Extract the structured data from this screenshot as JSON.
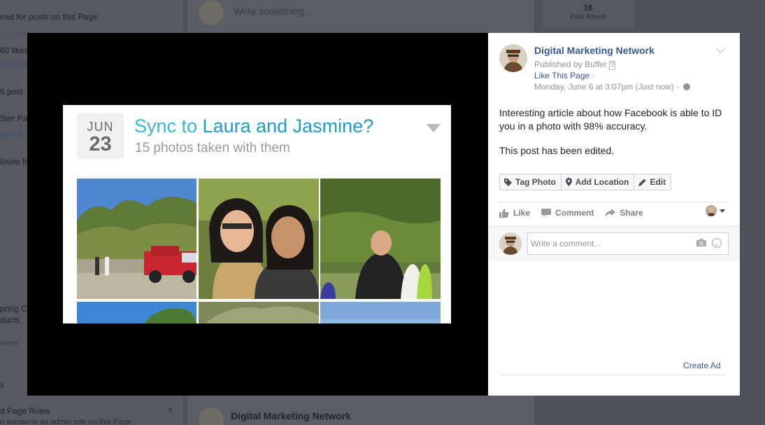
{
  "background_page": {
    "left_column_fragments": [
      "ead for posts on this Page",
      "60 likes",
      "hen Ge",
      "6 post",
      "See Pa",
      "ppa Su",
      "Invite fr",
      "pring C",
      "ducts",
      "www",
      "s"
    ],
    "composer_placeholder": "Write something...",
    "post_reach_count": "16",
    "post_reach_label": "Post Reach",
    "page_roles_title": "d Page Roles",
    "page_roles_subtitle": "n someone as admin role on this Page",
    "page_roles_close": "×",
    "bottom_post_author": "Digital Marketing Network"
  },
  "photo": {
    "date_month": "JUN",
    "date_day": "23",
    "title_prefix": "Sync to ",
    "title_names": "Laura and Jasmine?",
    "subtitle": "15 photos taken with them"
  },
  "sidebar": {
    "page_name": "Digital Marketing Network",
    "published_by": "Published by Buffer",
    "published_help": "?",
    "like_page_label": "Like This Page",
    "like_page_separator": "·",
    "timestamp": "Monday, June 6 at 3:07pm (Just now)",
    "timestamp_separator": "·",
    "post_text": "Interesting article about how Facebook is able to ID you in a photo with 98% accuracy.",
    "edited_note": "This post has been edited.",
    "photo_actions": {
      "tag_photo": "Tag Photo",
      "add_location": "Add Location",
      "edit": "Edit"
    },
    "reactions": {
      "like": "Like",
      "comment": "Comment",
      "share": "Share"
    },
    "comment_placeholder": "Write a comment...",
    "create_ad": "Create Ad"
  },
  "colors": {
    "facebook_link": "#365899",
    "card_title_accent": "#3ab4d8",
    "overlay": "#000000",
    "muted_text": "#90949c"
  },
  "icons": [
    "globe-icon",
    "menu-chevron-icon",
    "tag-icon",
    "location-pin-icon",
    "pencil-icon",
    "thumbs-up-icon",
    "comment-icon",
    "share-arrow-icon",
    "camera-icon",
    "emoji-icon",
    "chevron-down-icon"
  ]
}
